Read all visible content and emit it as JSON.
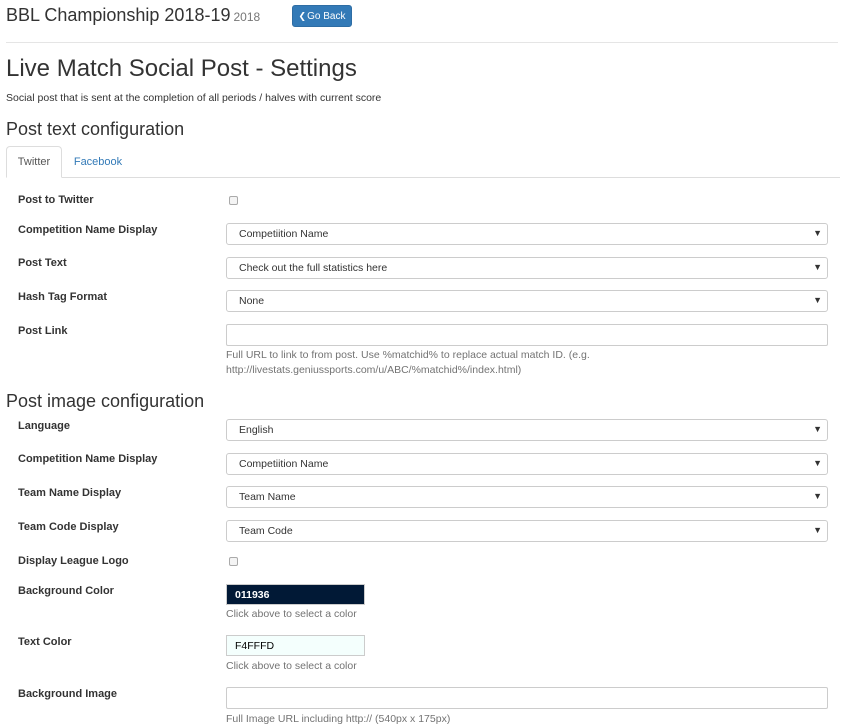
{
  "header": {
    "title": "BBL Championship 2018-19",
    "year": "2018",
    "back_label": "Go Back"
  },
  "page": {
    "title": "Live Match Social Post - Settings",
    "description": "Social post that is sent at the completion of all periods / halves with current score"
  },
  "text_config": {
    "heading": "Post text configuration",
    "tabs": [
      {
        "label": "Twitter",
        "active": true
      },
      {
        "label": "Facebook",
        "active": false
      }
    ],
    "post_to_twitter_label": "Post to Twitter",
    "post_to_twitter_checked": false,
    "competition_label": "Competition Name Display",
    "competition_value": "Competiition Name",
    "post_text_label": "Post Text",
    "post_text_value": "Check out the full statistics here",
    "hashtag_label": "Hash Tag Format",
    "hashtag_value": "None",
    "post_link_label": "Post Link",
    "post_link_value": "",
    "post_link_help_1": "Full URL to link to from post. Use %matchid% to replace actual match ID. (e.g.",
    "post_link_help_2": "http://livestats.geniussports.com/u/ABC/%matchid%/index.html)"
  },
  "image_config": {
    "heading": "Post image configuration",
    "language_label": "Language",
    "language_value": "English",
    "competition_label": "Competition Name Display",
    "competition_value": "Competiition Name",
    "team_name_label": "Team Name Display",
    "team_name_value": "Team Name",
    "team_code_label": "Team Code Display",
    "team_code_value": "Team Code",
    "league_logo_label": "Display League Logo",
    "league_logo_checked": false,
    "bg_color_label": "Background Color",
    "bg_color_value": "011936",
    "bg_color_hex": "#011936",
    "color_help": "Click above to select a color",
    "text_color_label": "Text Color",
    "text_color_value": "F4FFFD",
    "text_color_hex": "#F4FFFD",
    "bg_image_label": "Background Image",
    "bg_image_value": "",
    "bg_image_help": "Full Image URL including http:// (540px x 175px)"
  },
  "colors": {
    "primary": "#337ab7",
    "border": "#cccccc",
    "help_text": "#737373"
  }
}
